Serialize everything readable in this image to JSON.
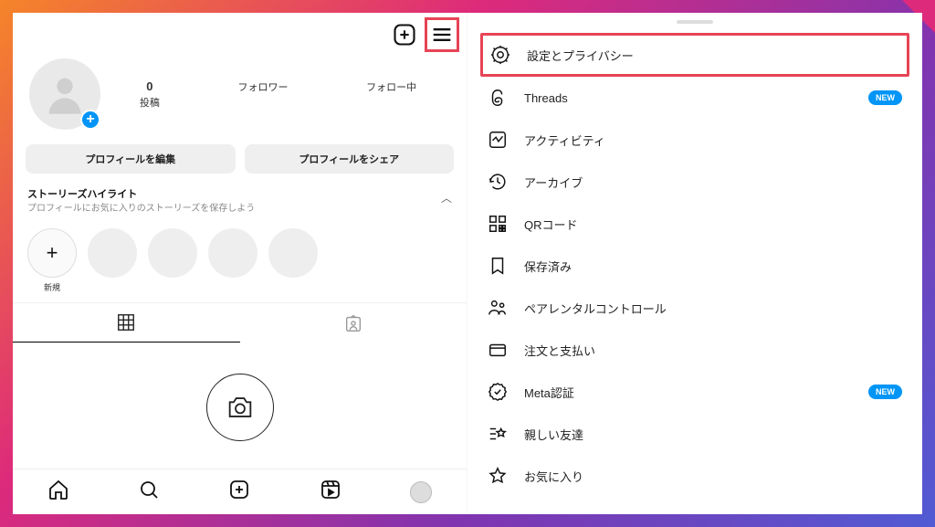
{
  "left": {
    "stats": {
      "posts_count": "0",
      "posts_label": "投稿",
      "followers_label": "フォロワー",
      "following_label": "フォロー中"
    },
    "buttons": {
      "edit_profile": "プロフィールを編集",
      "share_profile": "プロフィールをシェア"
    },
    "story_highlight": {
      "title": "ストーリーズハイライト",
      "subtitle": "プロフィールにお気に入りのストーリーズを保存しよう",
      "new_label": "新規"
    }
  },
  "right": {
    "items": [
      {
        "label": "設定とプライバシー",
        "icon": "gear",
        "highlight": true
      },
      {
        "label": "Threads",
        "icon": "threads",
        "badge": "NEW"
      },
      {
        "label": "アクティビティ",
        "icon": "activity"
      },
      {
        "label": "アーカイブ",
        "icon": "archive"
      },
      {
        "label": "QRコード",
        "icon": "qr"
      },
      {
        "label": "保存済み",
        "icon": "bookmark"
      },
      {
        "label": "ペアレンタルコントロール",
        "icon": "parental"
      },
      {
        "label": "注文と支払い",
        "icon": "card"
      },
      {
        "label": "Meta認証",
        "icon": "verified",
        "badge": "NEW"
      },
      {
        "label": "親しい友達",
        "icon": "closefriends"
      },
      {
        "label": "お気に入り",
        "icon": "star"
      }
    ]
  }
}
